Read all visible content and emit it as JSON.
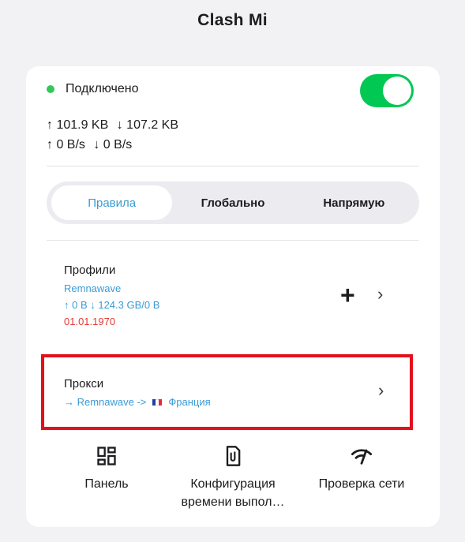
{
  "app": {
    "title": "Clash Mi"
  },
  "status": {
    "label": "Подключено",
    "enabled": true,
    "dot_color": "#34c759"
  },
  "traffic": {
    "upload_total": "↑ 101.9 KB",
    "download_total": "↓ 107.2 KB",
    "upload_speed": "↑ 0 B/s",
    "download_speed": "↓ 0 B/s"
  },
  "modes": {
    "selected": "Правила",
    "items": [
      "Правила",
      "Глобально",
      "Напрямую"
    ]
  },
  "profile": {
    "title": "Профили",
    "name": "Remnawave",
    "usage": "↑ 0 B ↓ 124.3 GB/0 B",
    "date": "01.01.1970",
    "add_icon": "plus-icon",
    "chevron_icon": "chevron-right-icon"
  },
  "proxy": {
    "title": "Прокси",
    "route_prefix": "→ Remnawave ->",
    "country": "Франция",
    "flag_icon": "france-flag-icon",
    "chevron_icon": "chevron-right-icon"
  },
  "bottom_actions": [
    {
      "label": "Панель",
      "icon": "dashboard-icon"
    },
    {
      "label": "Конфигурация времени выпол…",
      "line1": "Конфигурация",
      "line2": "времени выпол…",
      "icon": "file-attachment-icon"
    },
    {
      "label": "Проверка сети",
      "icon": "network-check-icon"
    }
  ],
  "colors": {
    "accent": "#3a9bd5",
    "toggle_on": "#00c853",
    "danger": "#e53935",
    "highlight_border": "#e3101c"
  }
}
